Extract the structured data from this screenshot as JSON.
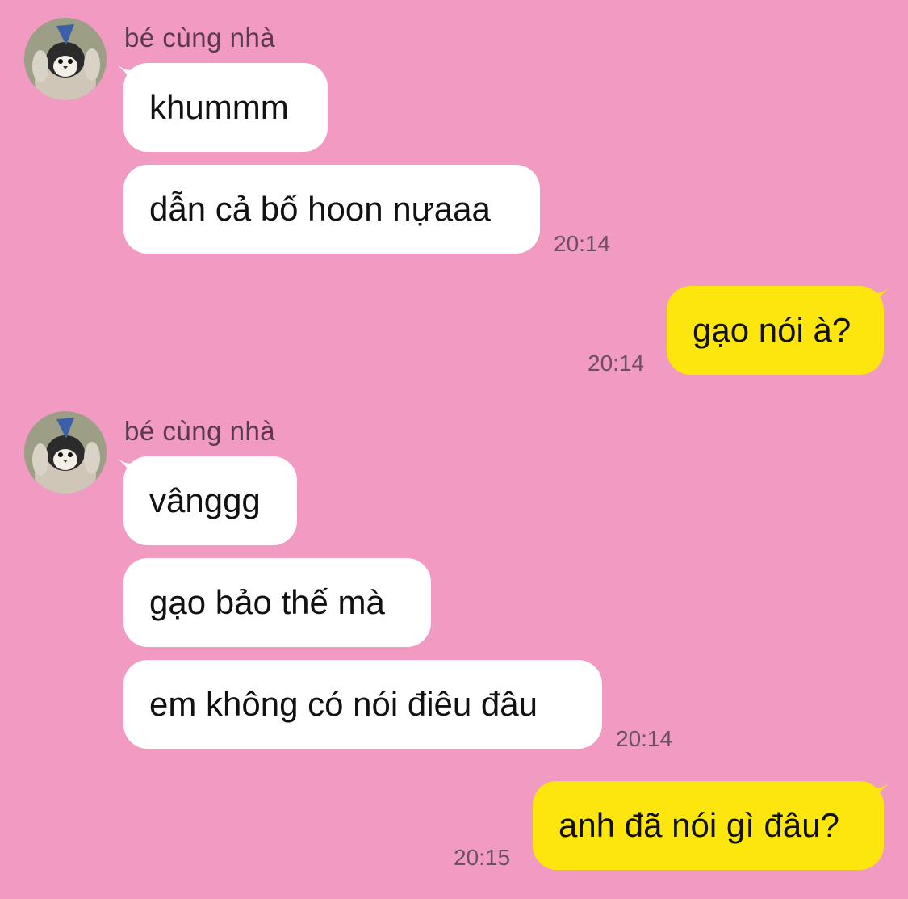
{
  "chat": {
    "contact_name": "bé cùng nhà",
    "colors": {
      "background": "#f29bc2",
      "received_bubble": "#ffffff",
      "sent_bubble": "#fde60e"
    },
    "groups": [
      {
        "sender": "bé cùng nhà",
        "avatar_icon": "penguin-chick-avatar-icon",
        "messages": [
          "khummm",
          "dẫn cả bố hoon nựaaa"
        ],
        "time": "20:14"
      },
      {
        "sender": "me",
        "messages": [
          "gạo nói à?"
        ],
        "time": "20:14"
      },
      {
        "sender": "bé cùng nhà",
        "avatar_icon": "penguin-chick-avatar-icon",
        "messages": [
          "vânggg",
          "gạo bảo thế mà",
          "em không có nói điêu đâu"
        ],
        "time": "20:14"
      },
      {
        "sender": "me",
        "messages": [
          "anh đã nói gì đâu?"
        ],
        "time": "20:15"
      }
    ]
  }
}
